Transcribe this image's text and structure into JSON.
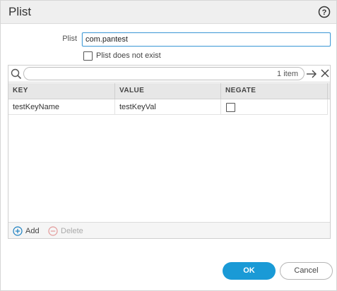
{
  "dialog": {
    "title": "Plist",
    "help_icon": "question-circle-icon"
  },
  "form": {
    "plist_label": "Plist",
    "plist_value": "com.pantest",
    "not_exist_label": "Plist does not exist",
    "not_exist_checked": false
  },
  "grid": {
    "search_placeholder": "",
    "item_count": "1 item",
    "icons": {
      "search": "search-icon",
      "apply": "arrow-right-icon",
      "clear": "close-icon"
    },
    "columns": [
      "KEY",
      "VALUE",
      "NEGATE"
    ],
    "rows": [
      {
        "key": "testKeyName",
        "value": "testKeyVal",
        "negate": false
      }
    ],
    "add_label": "Add",
    "delete_label": "Delete",
    "add_icon": "plus-circle-icon",
    "delete_icon": "minus-circle-icon"
  },
  "buttons": {
    "ok": "OK",
    "cancel": "Cancel"
  },
  "colors": {
    "accent": "#1a9ad6",
    "focus_border": "#4a9fd8",
    "disabled": "#aaaaaa"
  }
}
